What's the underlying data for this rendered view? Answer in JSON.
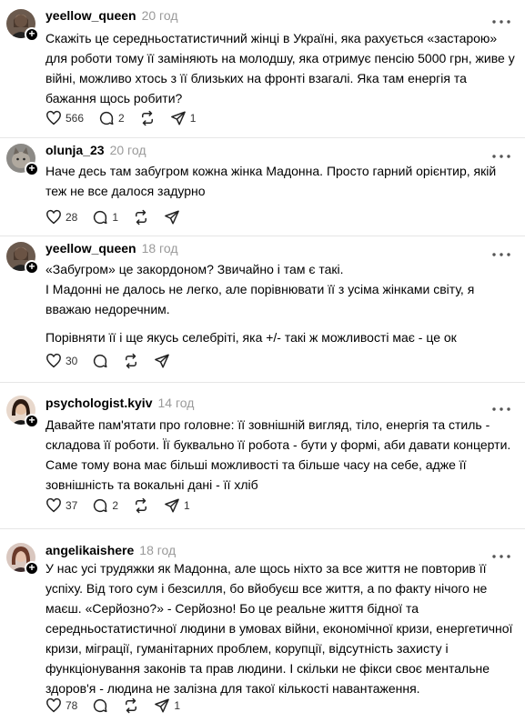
{
  "posts": [
    {
      "username": "yeellow_queen",
      "time": "20 год",
      "paragraphs": [
        "Скажіть це середньостатистичний жінці в Україні, яка рахується «застарою» для роботи тому її заміняють на молодшу, яка отримує пенсію 5000 грн, живе у війні, можливо хтось з її близьких на фронті взагалі. Яка там енергія та бажання щось робити?"
      ],
      "likes": "566",
      "replies": "2",
      "reposts": "",
      "shares": "1"
    },
    {
      "username": "olunja_23",
      "time": "20 год",
      "paragraphs": [
        "Наче десь там забугром кожна жінка Мадонна. Просто гарний орієнтир, якій теж не все далося задурно"
      ],
      "likes": "28",
      "replies": "1",
      "reposts": "",
      "shares": ""
    },
    {
      "username": "yeellow_queen",
      "time": "18 год",
      "paragraphs": [
        "«Забугром» це закордоном? Звичайно і там є такі.",
        "І Мадонні не далось не легко, але порівнювати її з усіма жінками світу, я вважаю недоречним.",
        "Порівняти її і ще якусь селебріті, яка +/- такі ж можливості має - це ок"
      ],
      "likes": "30",
      "replies": "",
      "reposts": "",
      "shares": ""
    },
    {
      "username": "psychologist.kyiv",
      "time": "14 год",
      "paragraphs": [
        "Давайте пам'ятати про головне: її зовнішній вигляд, тіло, енергія та стиль - складова її роботи. Її буквально її робота - бути у формі, аби давати концерти. Саме тому вона має більші можливості та більше часу на себе, адже її зовнішність та вокальні дані - її хліб"
      ],
      "likes": "37",
      "replies": "2",
      "reposts": "",
      "shares": "1"
    },
    {
      "username": "angelikaishere",
      "time": "18 год",
      "paragraphs": [
        "У нас усі трудяжки як Мадонна, але щось ніхто за все життя не повторив її успіху. Від того сум і безсилля, бо вйобуєш все життя, а по факту нічого не маєш. «Серйозно?» - Серйозно! Бо це реальне життя бідної та середньостатистичної людини в умовах війни, економічної кризи, енергетичної кризи, міграції, гуманітарних проблем, корупції, відсутність захисту і функціонування законів та прав людини. І скільки не фікси своє ментальне здоров'я - людина не залізна для такої кількості навантаження."
      ],
      "likes": "78",
      "replies": "",
      "reposts": "",
      "shares": "1"
    }
  ],
  "icons": {
    "like": "heart-icon",
    "reply": "comment-icon",
    "repost": "repost-icon",
    "share": "share-icon",
    "more": "more-icon",
    "follow": "plus-icon"
  },
  "colors": {
    "text": "#000000",
    "muted": "#9a9a9a",
    "divider": "#e6e6e6"
  }
}
